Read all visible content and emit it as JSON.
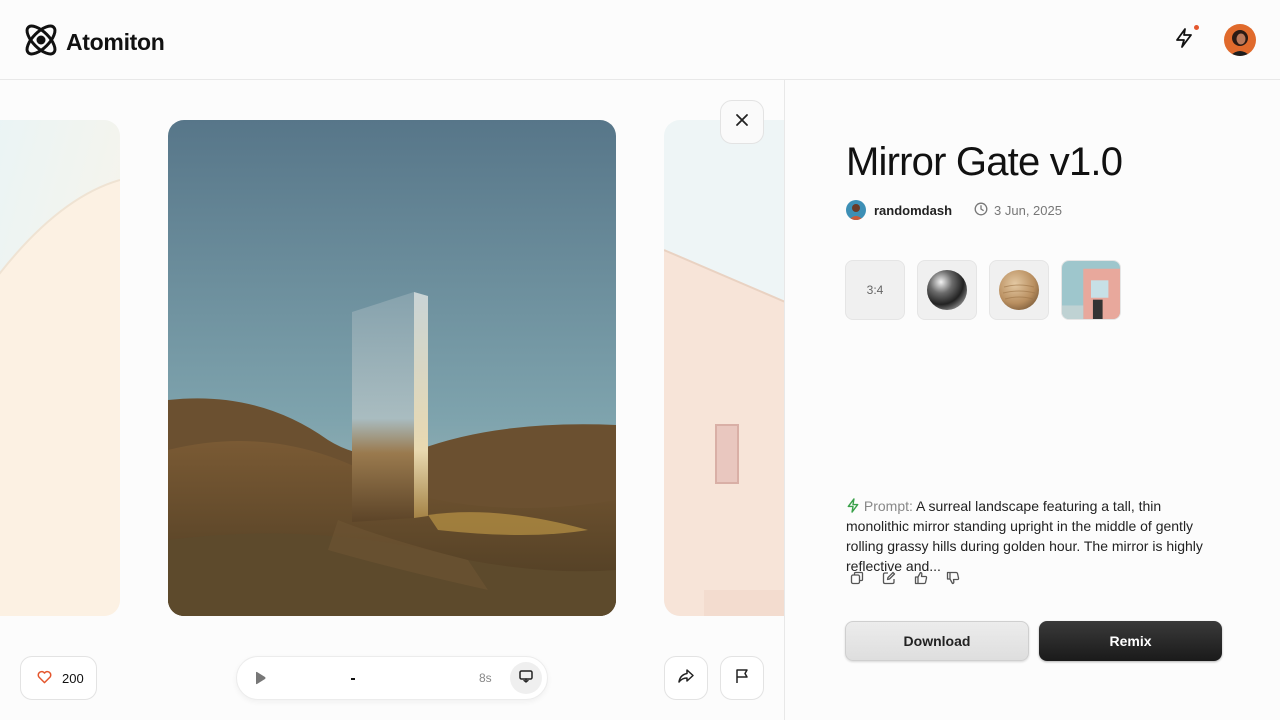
{
  "app": {
    "name": "Atomiton"
  },
  "header": {
    "bolt_icon": "bolt-icon",
    "notification_color": "#e4572e"
  },
  "media": {
    "likes": "200",
    "duration": "8s"
  },
  "detail": {
    "title": "Mirror Gate v1.0",
    "author": "randomdash",
    "date": "3 Jun, 2025",
    "aspect_ratio": "3:4",
    "prompt_label": "Prompt:",
    "prompt_text": "A surreal landscape featuring a tall, thin monolithic mirror standing upright in the middle of gently rolling grassy hills during golden hour. The mirror is highly reflective and...",
    "download_label": "Download",
    "remix_label": "Remix"
  },
  "colors": {
    "accent": "#e4572e",
    "prompt_icon": "#3aa14a",
    "primary_button": "#222222"
  }
}
